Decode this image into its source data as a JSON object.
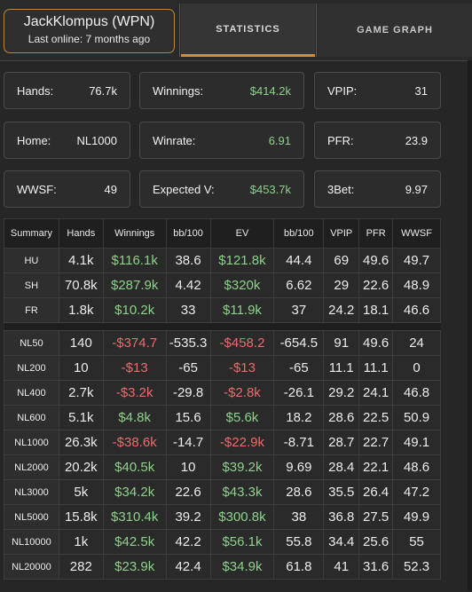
{
  "player": {
    "name": "JackKlompus (WPN)",
    "last_online": "Last online: 7 months ago"
  },
  "tabs": [
    "STATISTICS",
    "GAME GRAPH"
  ],
  "stats": [
    {
      "label": "Hands:",
      "value": "76.7k",
      "color": "#f2f2f2"
    },
    {
      "label": "Winnings:",
      "value": "$414.2k",
      "color": "#8fd08c"
    },
    {
      "label": "VPIP:",
      "value": "31",
      "color": "#f2f2f2"
    },
    {
      "label": "Home:",
      "value": "NL1000",
      "color": "#f2f2f2"
    },
    {
      "label": "Winrate:",
      "value": "6.91",
      "color": "#8fd08c"
    },
    {
      "label": "PFR:",
      "value": "23.9",
      "color": "#f2f2f2"
    },
    {
      "label": "WWSF:",
      "value": "49",
      "color": "#f2f2f2"
    },
    {
      "label": "Expected V:",
      "value": "$453.7k",
      "color": "#8fd08c"
    },
    {
      "label": "3Bet:",
      "value": "9.97",
      "color": "#f2f2f2"
    }
  ],
  "table": {
    "headers": [
      "Summary",
      "Hands",
      "Winnings",
      "bb/100",
      "EV",
      "bb/100",
      "VPIP",
      "PFR",
      "WWSF"
    ],
    "group1": [
      [
        "HU",
        "4.1k",
        "$116.1k",
        "38.6",
        "$121.8k",
        "44.4",
        "69",
        "49.6",
        "49.7"
      ],
      [
        "SH",
        "70.8k",
        "$287.9k",
        "4.42",
        "$320k",
        "6.62",
        "29",
        "22.6",
        "48.9"
      ],
      [
        "FR",
        "1.8k",
        "$10.2k",
        "33",
        "$11.9k",
        "37",
        "24.2",
        "18.1",
        "46.6"
      ]
    ],
    "group2": [
      [
        "NL50",
        "140",
        "-$374.7",
        "-535.3",
        "-$458.2",
        "-654.5",
        "91",
        "49.6",
        "24"
      ],
      [
        "NL200",
        "10",
        "-$13",
        "-65",
        "-$13",
        "-65",
        "11.1",
        "11.1",
        "0"
      ],
      [
        "NL400",
        "2.7k",
        "-$3.2k",
        "-29.8",
        "-$2.8k",
        "-26.1",
        "29.2",
        "24.1",
        "46.8"
      ],
      [
        "NL600",
        "5.1k",
        "$4.8k",
        "15.6",
        "$5.6k",
        "18.2",
        "28.6",
        "22.5",
        "50.9"
      ],
      [
        "NL1000",
        "26.3k",
        "-$38.6k",
        "-14.7",
        "-$22.9k",
        "-8.71",
        "28.7",
        "22.7",
        "49.1"
      ],
      [
        "NL2000",
        "20.2k",
        "$40.5k",
        "10",
        "$39.2k",
        "9.69",
        "28.4",
        "22.1",
        "48.6"
      ],
      [
        "NL3000",
        "5k",
        "$34.2k",
        "22.6",
        "$43.3k",
        "28.6",
        "35.5",
        "26.4",
        "47.2"
      ],
      [
        "NL5000",
        "15.8k",
        "$310.4k",
        "39.2",
        "$300.8k",
        "38",
        "36.8",
        "27.5",
        "49.9"
      ],
      [
        "NL10000",
        "1k",
        "$42.5k",
        "42.2",
        "$56.1k",
        "55.8",
        "34.4",
        "25.6",
        "55"
      ],
      [
        "NL20000",
        "282",
        "$23.9k",
        "42.4",
        "$34.9k",
        "61.8",
        "41",
        "31.6",
        "52.3"
      ]
    ]
  },
  "colors": {
    "accent": "#e08a2c",
    "positive": "#8fd08c",
    "negative": "#ee6b6b"
  }
}
